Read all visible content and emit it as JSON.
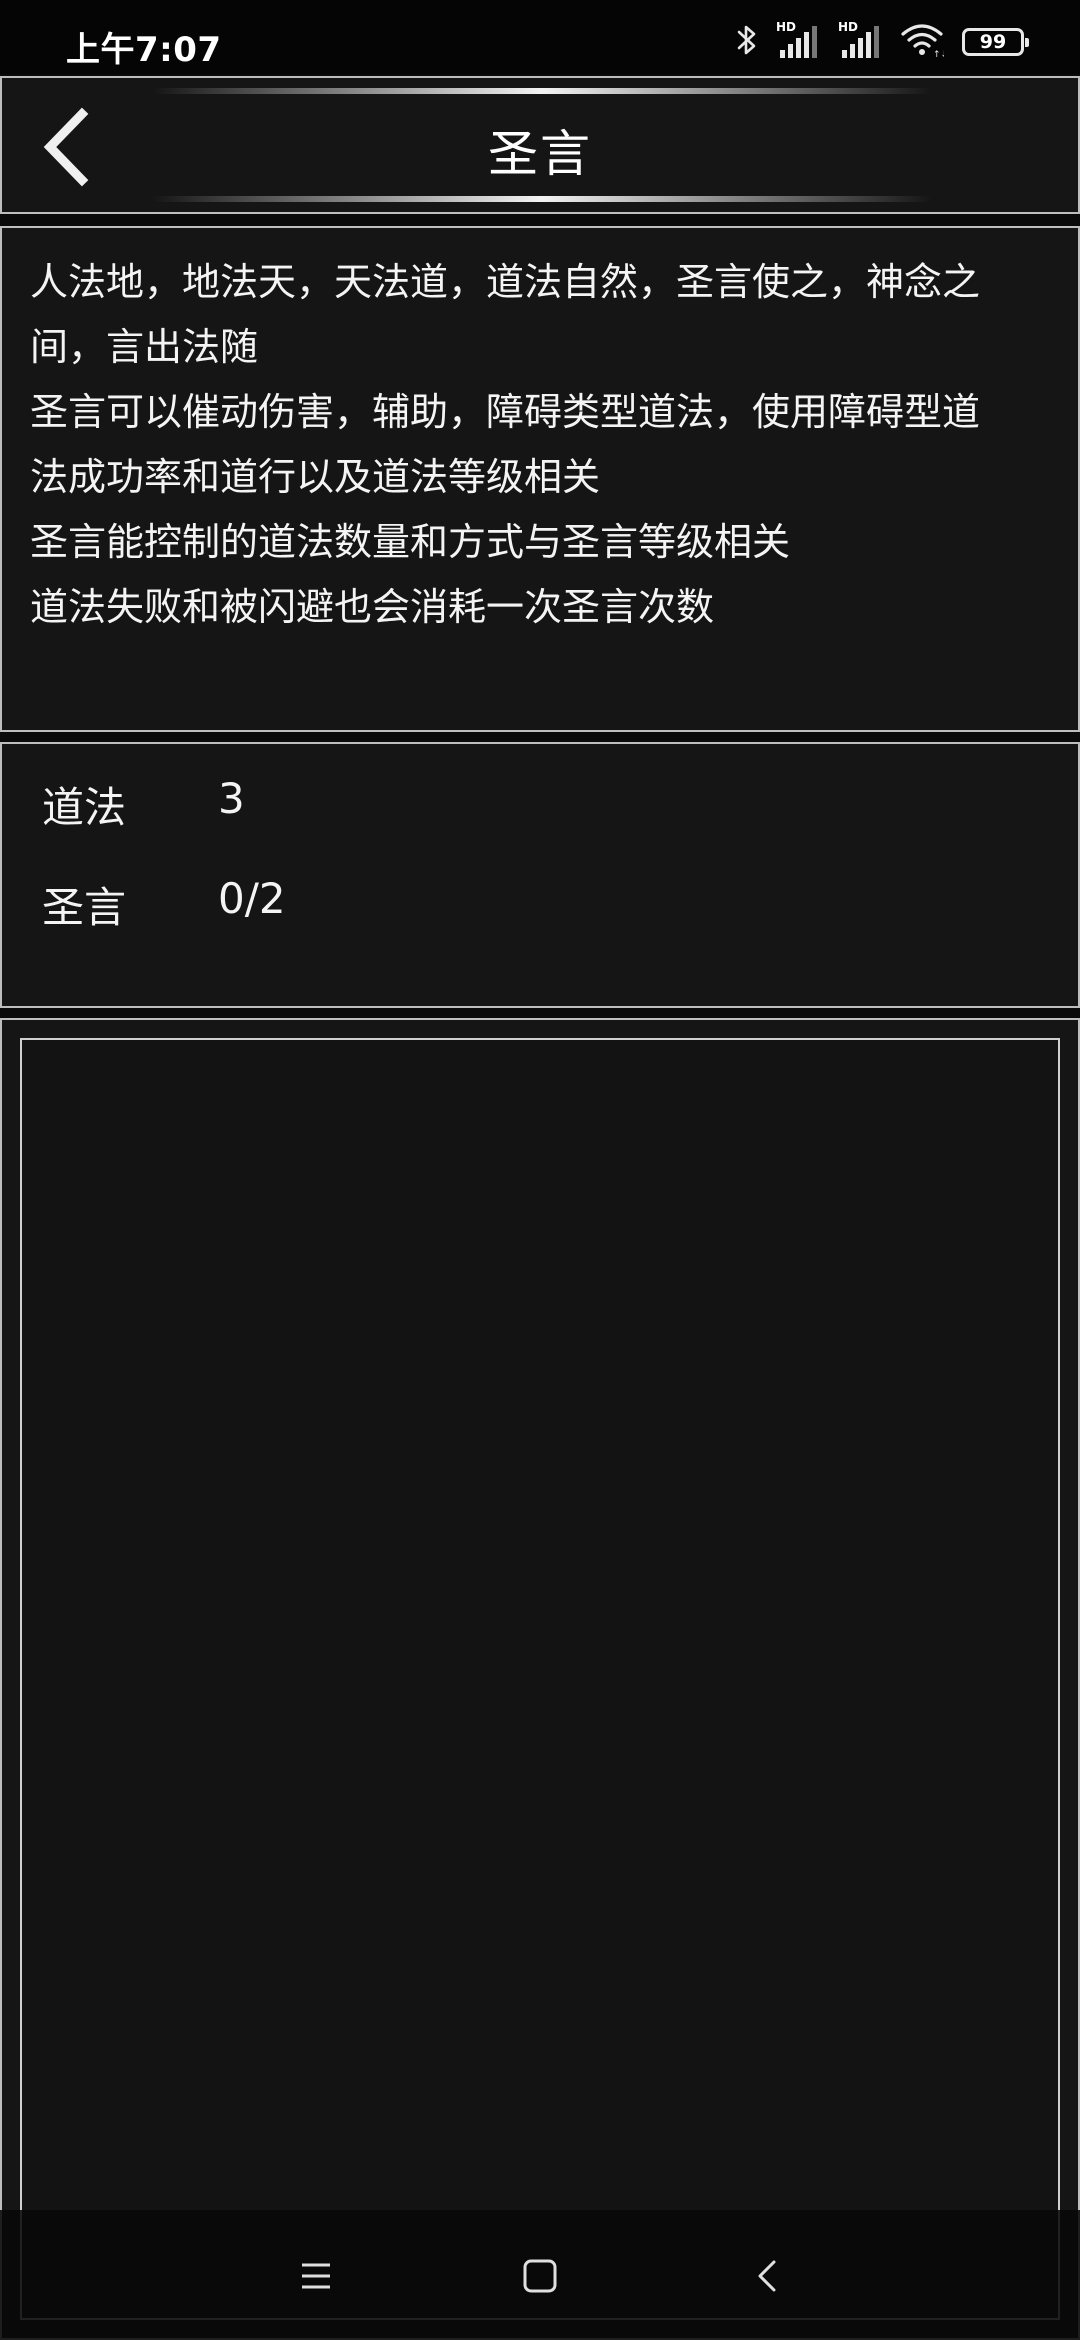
{
  "status_bar": {
    "time": "上午7:07",
    "signal_1_label": "HD",
    "signal_2_label": "HD",
    "battery": "99",
    "icons": [
      "bluetooth-icon",
      "signal-icon",
      "signal-icon",
      "wifi-icon",
      "battery-icon"
    ]
  },
  "header": {
    "title": "圣言",
    "back_icon": "chevron-left-icon"
  },
  "description": {
    "lines": [
      "人法地，地法天，天法道，道法自然，圣言使之，神念之",
      "间，言出法随",
      "圣言可以催动伤害，辅助，障碍类型道法，使用障碍型道",
      "法成功率和道行以及道法等级相关",
      "圣言能控制的道法数量和方式与圣言等级相关",
      "道法失败和被闪避也会消耗一次圣言次数"
    ]
  },
  "stats": [
    {
      "label": "道法",
      "value": "3"
    },
    {
      "label": "圣言",
      "value": "0/2"
    }
  ],
  "nav_bar": {
    "icons": [
      "menu-icon",
      "home-icon",
      "back-icon"
    ]
  },
  "colors": {
    "background": "#0a0a0a",
    "panel": "#151515",
    "border": "#bdbdbd",
    "text": "#f4f4f4"
  }
}
